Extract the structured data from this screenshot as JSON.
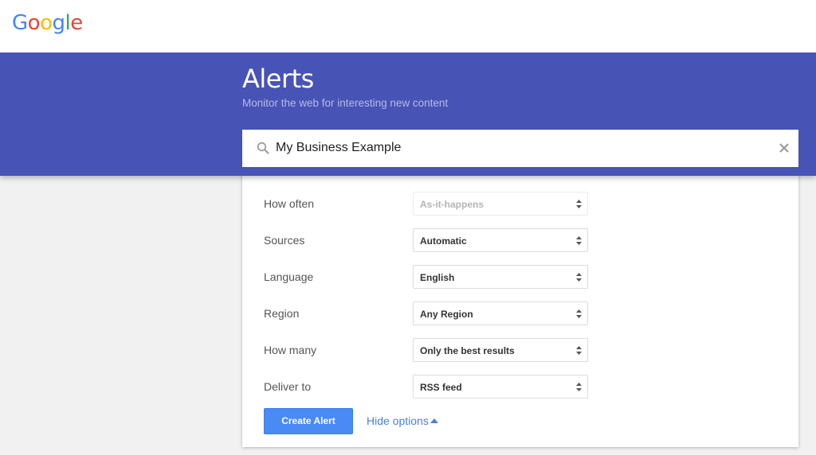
{
  "brand": {
    "letters": [
      {
        "ch": "G",
        "color": "#4285f4"
      },
      {
        "ch": "o",
        "color": "#ea4335"
      },
      {
        "ch": "o",
        "color": "#fbbc05"
      },
      {
        "ch": "g",
        "color": "#4285f4"
      },
      {
        "ch": "l",
        "color": "#34a853"
      },
      {
        "ch": "e",
        "color": "#ea4335"
      }
    ]
  },
  "header": {
    "title": "Alerts",
    "subtitle": "Monitor the web for interesting new content"
  },
  "search": {
    "value": "My Business Example",
    "icon": "search-icon",
    "clear_icon": "close-icon"
  },
  "options": [
    {
      "label": "How often",
      "value": "As-it-happens",
      "disabled": true
    },
    {
      "label": "Sources",
      "value": "Automatic",
      "disabled": false
    },
    {
      "label": "Language",
      "value": "English",
      "disabled": false
    },
    {
      "label": "Region",
      "value": "Any Region",
      "disabled": false
    },
    {
      "label": "How many",
      "value": "Only the best results",
      "disabled": false
    },
    {
      "label": "Deliver to",
      "value": "RSS feed",
      "disabled": false
    }
  ],
  "actions": {
    "create_label": "Create Alert",
    "hide_options_label": "Hide options"
  },
  "colors": {
    "header_bg": "#4753b5",
    "primary_button": "#4a8af4",
    "link": "#4a7fe0"
  }
}
